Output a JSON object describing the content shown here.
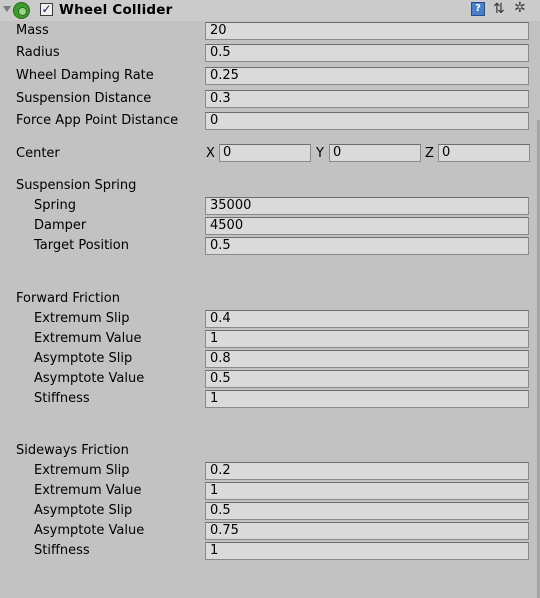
{
  "component": {
    "title": "Wheel Collider",
    "enabled_mark": "✓",
    "help_glyph": "?",
    "preset_glyph": "⇅",
    "gear_glyph": "✲"
  },
  "basic": {
    "mass": {
      "label": "Mass",
      "value": "20"
    },
    "radius": {
      "label": "Radius",
      "value": "0.5"
    },
    "damping": {
      "label": "Wheel Damping Rate",
      "value": "0.25"
    },
    "suspension_distance": {
      "label": "Suspension Distance",
      "value": "0.3"
    },
    "force_app": {
      "label": "Force App Point Distance",
      "value": "0"
    }
  },
  "center": {
    "label": "Center",
    "x_label": "X",
    "x": "0",
    "y_label": "Y",
    "y": "0",
    "z_label": "Z",
    "z": "0"
  },
  "suspension_spring": {
    "heading": "Suspension Spring",
    "spring": {
      "label": "Spring",
      "value": "35000"
    },
    "damper": {
      "label": "Damper",
      "value": "4500"
    },
    "target": {
      "label": "Target Position",
      "value": "0.5"
    }
  },
  "forward_friction": {
    "heading": "Forward Friction",
    "extremum_slip": {
      "label": "Extremum Slip",
      "value": "0.4"
    },
    "extremum_value": {
      "label": "Extremum Value",
      "value": "1"
    },
    "asymptote_slip": {
      "label": "Asymptote Slip",
      "value": "0.8"
    },
    "asymptote_value": {
      "label": "Asymptote Value",
      "value": "0.5"
    },
    "stiffness": {
      "label": "Stiffness",
      "value": "1"
    }
  },
  "sideways_friction": {
    "heading": "Sideways Friction",
    "extremum_slip": {
      "label": "Extremum Slip",
      "value": "0.2"
    },
    "extremum_value": {
      "label": "Extremum Value",
      "value": "1"
    },
    "asymptote_slip": {
      "label": "Asymptote Slip",
      "value": "0.5"
    },
    "asymptote_value": {
      "label": "Asymptote Value",
      "value": "0.75"
    },
    "stiffness": {
      "label": "Stiffness",
      "value": "1"
    }
  }
}
